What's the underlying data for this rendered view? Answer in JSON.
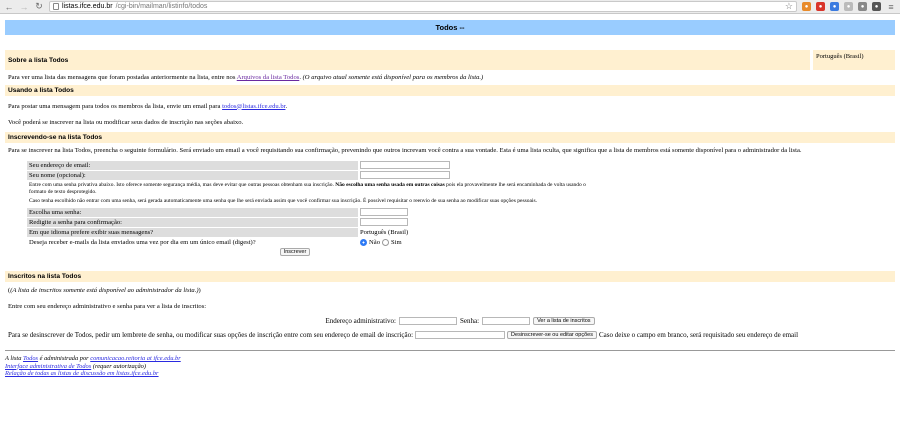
{
  "browser": {
    "url_host": "listas.ifce.edu.br",
    "url_path": "/cgi-bin/mailman/listinfo/todos"
  },
  "banner_title": "Todos --",
  "about": {
    "heading": "Sobre a lista Todos",
    "language": "Português (Brasil)",
    "text_before": "Para ver uma lista das mensagens que foram postadas anteriormente na lista, entre nos ",
    "archive_link": "Arquivos da lista Todos",
    "text_after": ". ",
    "note": "(O arquivo atual somente está disponível para os membros da lista.)"
  },
  "using": {
    "heading": "Usando a lista Todos",
    "post_text": "Para postar uma mensagem para todos os membros da lista, envie um email para ",
    "post_email": "todos@listas.ifce.edu.br",
    "post_end": ".",
    "subscribe_text": "Você poderá se inscrever na lista ou modificar seus dados de inscrição nas seções abaixo."
  },
  "subscribing": {
    "heading": "Inscrevendo-se na lista Todos",
    "intro": "Para se inscrever na lista Todos, preencha o seguinte formulário. Será enviado um email a você requisitando sua confirmação, prevenindo que outros increvam você contra a sua vontade. Esta é uma lista oculta, que significa que a lista de membros está somente disponível para o administrador da lista.",
    "email_label": "Seu endereço de email:",
    "name_label": "Seu nome (opcional):",
    "privacy_note_a": "Entre com uma senha privativa abaixo. Isto oferece somente segurança média, mas deve evitar que outras pessoas obtenham sua inscrição. ",
    "privacy_note_bold": "Não escolha uma senha usada em outras coisas",
    "privacy_note_b": " pois ela provavelmente lhe será encaminhada de volta usando o formato de texto desprotegido.",
    "privacy_note_2": "Caso tenha escolhido não entrar com uma senha, será gerada automaticamente uma senha que lhe será enviada assim que você confirmar sua inscrição. É possível requisitar o reenvio de sua senha ao modificar suas opções pessoais.",
    "password_label": "Escolha uma senha:",
    "confirm_label": "Redigite a senha para confirmação:",
    "language_label": "Em que idioma prefere exibir suas mensagens?",
    "language_value": "Português (Brasil)",
    "digest_label": "Deseja receber e-mails da lista enviados uma vez por dia em um único email (digest)?",
    "digest_no": "Não",
    "digest_yes": "Sim",
    "digest_selected": "Não",
    "submit_label": "Inscrever"
  },
  "members": {
    "heading": "Inscritos na lista Todos",
    "note": "(A lista de inscritos somente está disponível ao administrador da lista.)",
    "admin_prompt": "Entre com seu endereço administrativo e senha para ver a lista de inscritos:",
    "admin_address_label": "Endereço administrativo:",
    "admin_password_label": "Senha:",
    "view_button": "Ver a lista de inscritos",
    "unsub_text": "Para se desinscrever de Todos, pedir um lembrete de senha, ou modificar suas opções de inscrição entre com seu endereço de email de inscrição:",
    "unsub_button": "Desinscrever-se ou editar opções",
    "unsub_after": "Caso deixe o campo em branco, será requisitado seu endereço de email"
  },
  "footer": {
    "admin_prefix": "A lista ",
    "list_link": "Todos",
    "admin_middle": " é administrada por ",
    "admin_email": "comunicacao.reitoria at ifce.edu.br",
    "admin_interface": "Interface administrativa de Todos",
    "auth_note": " (requer autorização)",
    "overview_link": "Relação de todas as listas de discussão em listas.ifce.edu.br"
  },
  "colors": {
    "banner": "#99ccff",
    "section": "#fff0d0",
    "form_label": "#dddddd",
    "link": "#2a2ae0"
  }
}
